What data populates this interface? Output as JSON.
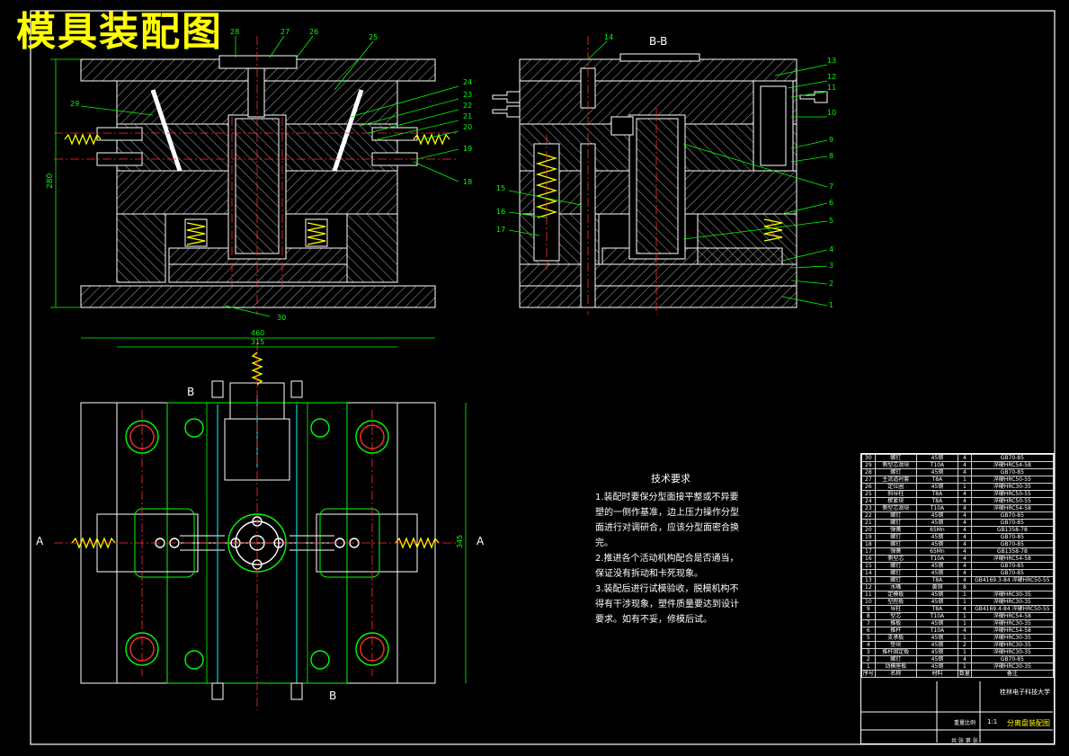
{
  "title": "模具装配图",
  "section_label": "B-B",
  "view_markers": {
    "a_left": "A",
    "a_right": "A",
    "b_top": "B",
    "b_bottom": "B"
  },
  "balloons_left": [
    "26",
    "27",
    "28",
    "25",
    "24",
    "23",
    "22",
    "21",
    "20",
    "19",
    "18",
    "29",
    "30"
  ],
  "balloons_right": [
    "14",
    "13",
    "12",
    "11",
    "10",
    "9",
    "8",
    "7",
    "6",
    "5",
    "4",
    "3",
    "2",
    "1",
    "15",
    "16",
    "17"
  ],
  "dims": {
    "height": "280",
    "width_outer": "460",
    "width_inner": "315",
    "height_plan": "345"
  },
  "technical_requirements": {
    "heading": "技术要求",
    "items": [
      "1.装配时要保分型面接平整或不异要塑的一侧作基准，边上压力操作分型面进行对调研合，应该分型面密合换完。",
      "2.推进各个活动机构配合是否通当，保证没有拆动和卡死现象。",
      "3.装配后进行试模验收，脱模机构不得有干涉现象，塑件质量要达到设计要求。如有不妥，修模后试。"
    ]
  },
  "bom_rows": [
    [
      "30",
      "螺钉",
      "45钢",
      "4",
      "GB70-85"
    ],
    [
      "29",
      "侧型芯滑块",
      "T10A",
      "4",
      "淬硬HRC54-58"
    ],
    [
      "28",
      "螺钉",
      "45钢",
      "4",
      "GB70-85"
    ],
    [
      "27",
      "主流道衬套",
      "T8A",
      "1",
      "淬硬HRC50-55"
    ],
    [
      "26",
      "定位圈",
      "45钢",
      "1",
      "淬硬HRC30-35"
    ],
    [
      "25",
      "斜导柱",
      "T8A",
      "4",
      "淬硬HRC50-55"
    ],
    [
      "24",
      "楔紧块",
      "T8A",
      "4",
      "淬硬HRC50-55"
    ],
    [
      "23",
      "侧型芯滑块",
      "T10A",
      "4",
      "淬硬HRC54-58"
    ],
    [
      "22",
      "螺钉",
      "45钢",
      "4",
      "GB70-85"
    ],
    [
      "21",
      "螺钉",
      "45钢",
      "4",
      "GB70-85"
    ],
    [
      "20",
      "弹簧",
      "65Mn",
      "4",
      "GB1358-78"
    ],
    [
      "19",
      "螺钉",
      "45钢",
      "4",
      "GB70-85"
    ],
    [
      "18",
      "螺钉",
      "45钢",
      "4",
      "GB70-85"
    ],
    [
      "17",
      "弹簧",
      "65Mn",
      "4",
      "GB1358-78"
    ],
    [
      "16",
      "侧型芯",
      "T10A",
      "4",
      "淬硬HRC54-58"
    ],
    [
      "15",
      "螺钉",
      "45钢",
      "4",
      "GB70-85"
    ],
    [
      "14",
      "螺钉",
      "45钢",
      "4",
      "GB70-85"
    ],
    [
      "13",
      "螺钉",
      "T8A",
      "4",
      "GB4169.3-84 淬硬HRC50-55"
    ],
    [
      "12",
      "水嘴",
      "黄铜",
      "8",
      ""
    ],
    [
      "11",
      "定模板",
      "45钢",
      "1",
      "淬硬HRC30-35"
    ],
    [
      "10",
      "型腔板",
      "45钢",
      "1",
      "淬硬HRC30-35"
    ],
    [
      "9",
      "导柱",
      "T8A",
      "4",
      "GB4169.4-84 淬硬HRC50-55"
    ],
    [
      "8",
      "型芯",
      "T10A",
      "1",
      "淬硬HRC54-58"
    ],
    [
      "7",
      "推板",
      "45钢",
      "1",
      "淬硬HRC30-35"
    ],
    [
      "6",
      "推杆",
      "T10A",
      "4",
      "淬硬HRC54-58"
    ],
    [
      "5",
      "支承板",
      "45钢",
      "1",
      "淬硬HRC30-35"
    ],
    [
      "4",
      "垫块",
      "45钢",
      "2",
      "淬硬HRC30-35"
    ],
    [
      "3",
      "推杆固定板",
      "45钢",
      "1",
      "淬硬HRC30-35"
    ],
    [
      "2",
      "螺钉",
      "45钢",
      "4",
      "GB70-85"
    ],
    [
      "1",
      "动模座板",
      "45钢",
      "1",
      "淬硬HRC30-35"
    ]
  ],
  "bom_header": [
    "序号",
    "名称",
    "材料",
    "数量",
    "备注"
  ],
  "title_block": {
    "school": "桂林电子科技大学",
    "drawing_name": "分离盘装配图",
    "scale_label": "重量比例",
    "ratio": "1:1",
    "sheet": "共 张 第 张"
  },
  "colors": {
    "background": "#000000",
    "lines": "#ffffff",
    "title": "#ffff00",
    "dims": "#00ff00",
    "centerlines": "#ff3030",
    "hatch": "#b4b4b4",
    "cyan": "#00ffff"
  }
}
